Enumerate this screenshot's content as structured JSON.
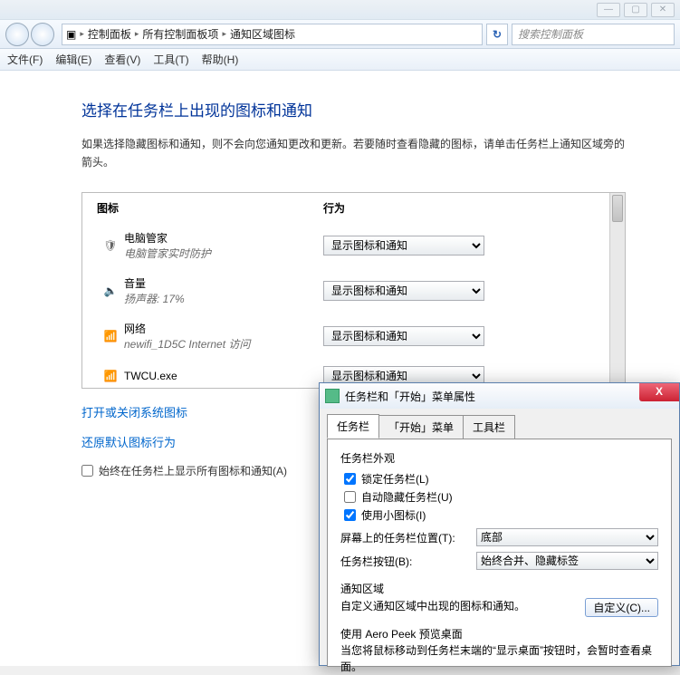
{
  "titlebar": {
    "min": "—",
    "max": "▢",
    "close": "✕"
  },
  "addr": {
    "root_icon": "▣",
    "crumbs": [
      "控制面板",
      "所有控制面板项",
      "通知区域图标"
    ],
    "sep": "▸",
    "refresh": "↻",
    "search_placeholder": "搜索控制面板"
  },
  "menu": [
    "文件(F)",
    "编辑(E)",
    "查看(V)",
    "工具(T)",
    "帮助(H)"
  ],
  "page": {
    "title": "选择在任务栏上出现的图标和通知",
    "desc": "如果选择隐藏图标和通知，则不会向您通知更改和更新。若要随时查看隐藏的图标，请单击任务栏上通知区域旁的箭头。",
    "col_icon": "图标",
    "col_behavior": "行为",
    "rows": [
      {
        "icon": "🛡",
        "name": "电脑管家",
        "sub": "电脑管家实时防护",
        "sel": "显示图标和通知"
      },
      {
        "icon": "🔈",
        "name": "音量",
        "sub": "扬声器: 17%",
        "sel": "显示图标和通知"
      },
      {
        "icon": "📶",
        "name": "网络",
        "sub": "newifi_1D5C Internet 访问",
        "sel": "显示图标和通知"
      },
      {
        "icon": "📶",
        "name": "TWCU.exe",
        "sub": "",
        "sel": "显示图标和通知"
      }
    ],
    "link1": "打开或关闭系统图标",
    "link2": "还原默认图标行为",
    "checkbox_label": "始终在任务栏上显示所有图标和通知(A)"
  },
  "dialog": {
    "title": "任务栏和「开始」菜单属性",
    "close": "X",
    "tabs": [
      "任务栏",
      "「开始」菜单",
      "工具栏"
    ],
    "appearance_title": "任务栏外观",
    "opts": {
      "lock": "锁定任务栏(L)",
      "autohide": "自动隐藏任务栏(U)",
      "smallicons": "使用小图标(I)"
    },
    "pos_label": "屏幕上的任务栏位置(T):",
    "pos_value": "底部",
    "btn_label": "任务栏按钮(B):",
    "btn_value": "始终合并、隐藏标签",
    "notif_title": "通知区域",
    "notif_desc": "自定义通知区域中出现的图标和通知。",
    "customize": "自定义(C)...",
    "peek_title": "使用 Aero Peek 预览桌面",
    "peek_desc": "当您将鼠标移动到任务栏末端的“显示桌面”按钮时，会暂时查看桌面。"
  }
}
